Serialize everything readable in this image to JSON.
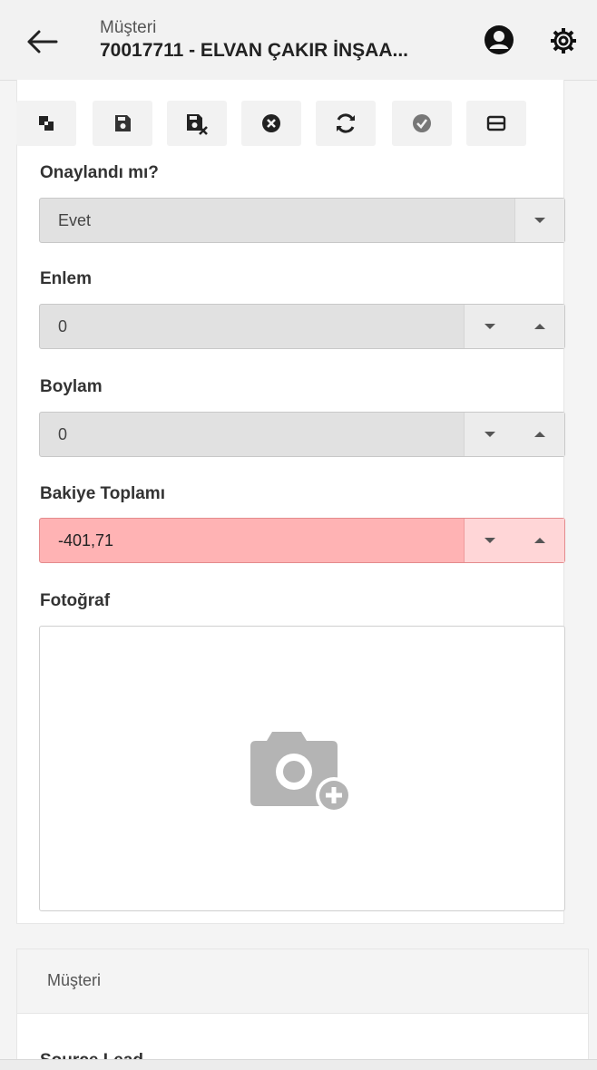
{
  "header": {
    "subtitle": "Müşteri",
    "title": "70017711 - ELVAN ÇAKIR İNŞAA..."
  },
  "toolbar": {
    "buttons": [
      "copy-icon",
      "save-icon",
      "save-close-icon",
      "cancel-icon",
      "refresh-icon",
      "approve-icon",
      "layout-icon"
    ]
  },
  "form": {
    "approved": {
      "label": "Onaylandı mı?",
      "value": "Evet"
    },
    "latitude": {
      "label": "Enlem",
      "value": "0"
    },
    "longitude": {
      "label": "Boylam",
      "value": "0"
    },
    "balance": {
      "label": "Bakiye Toplamı",
      "value": "-401,71",
      "color": "#ffb3b4"
    },
    "photo": {
      "label": "Fotoğraf",
      "icon": "add-photo-icon"
    }
  },
  "panel": {
    "title": "Müşteri",
    "next_label": "Source Lead"
  },
  "colors": {
    "header_bg": "#f2f2f2",
    "field_bg": "#e1e1e1",
    "negative_bg": "#ffb3b4"
  }
}
